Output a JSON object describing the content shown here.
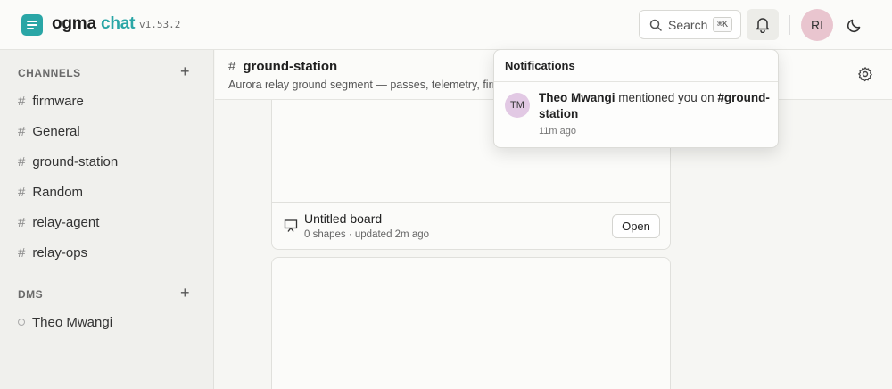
{
  "app": {
    "brand_part1": "ogma",
    "brand_part2": "chat",
    "version": "v1.53.2"
  },
  "header": {
    "search_label": "Search",
    "search_shortcut": "⌘K",
    "user_initials": "RI"
  },
  "sidebar": {
    "channels_heading": "CHANNELS",
    "channels": [
      {
        "label": "firmware"
      },
      {
        "label": "General"
      },
      {
        "label": "ground-station"
      },
      {
        "label": "Random"
      },
      {
        "label": "relay-agent"
      },
      {
        "label": "relay-ops"
      }
    ],
    "dms_heading": "DMS",
    "dms": [
      {
        "label": "Theo Mwangi"
      }
    ]
  },
  "channel": {
    "name": "ground-station",
    "description": "Aurora relay ground segment — passes, telemetry, firm"
  },
  "board": {
    "title": "Untitled board",
    "meta": "0 shapes · updated 2m ago",
    "open_label": "Open"
  },
  "notifications": {
    "title": "Notifications",
    "items": [
      {
        "avatar_initials": "TM",
        "actor": "Theo Mwangi",
        "action": " mentioned you on ",
        "target": "#ground-station",
        "time": "11m ago"
      }
    ]
  },
  "colors": {
    "accent": "#2aa6a6",
    "user_avatar": "#e9c5cf",
    "actor_avatar": "#e2c9e4"
  }
}
